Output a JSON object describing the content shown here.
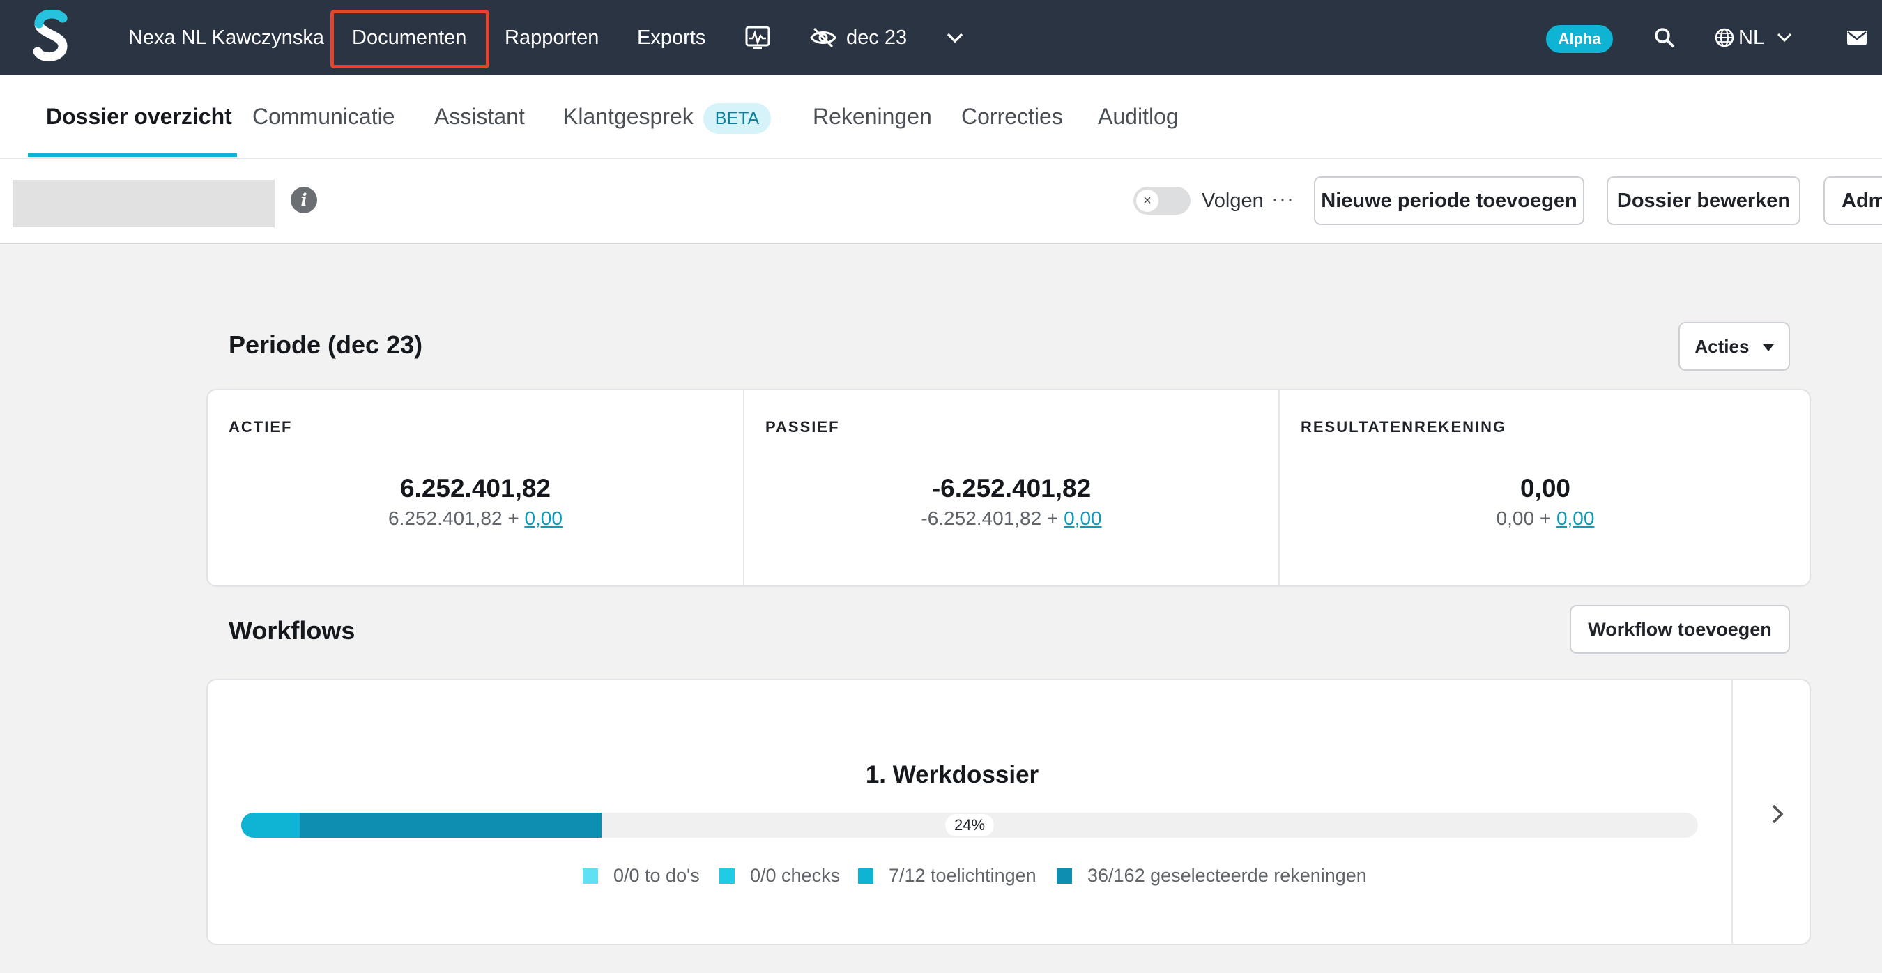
{
  "topnav": {
    "company": "Nexa NL Kawczynska",
    "items": [
      "Documenten",
      "Rapporten",
      "Exports"
    ],
    "period": "dec 23",
    "badge": "Alpha",
    "language": "NL",
    "icons": [
      "logo-icon",
      "activity-monitor-icon",
      "eye-off-icon",
      "chevron-down-icon",
      "search-icon",
      "globe-icon",
      "mail-icon"
    ]
  },
  "tabs": [
    {
      "label": "Dossier overzicht",
      "active": true
    },
    {
      "label": "Communicatie"
    },
    {
      "label": "Assistant"
    },
    {
      "label": "Klantgesprek",
      "badge": "BETA"
    },
    {
      "label": "Rekeningen"
    },
    {
      "label": "Correcties"
    },
    {
      "label": "Auditlog"
    }
  ],
  "toolbar": {
    "follow_label": "Volgen",
    "more": "···",
    "buttons": [
      "Nieuwe periode toevoegen",
      "Dossier bewerken",
      "Adm"
    ]
  },
  "period": {
    "title": "Periode (dec 23)",
    "actions_label": "Acties",
    "stats": [
      {
        "label": "ACTIEF",
        "value": "6.252.401,82",
        "base": "6.252.401,82 + ",
        "delta": "0,00"
      },
      {
        "label": "PASSIEF",
        "value": "-6.252.401,82",
        "base": "-6.252.401,82 + ",
        "delta": "0,00"
      },
      {
        "label": "RESULTATENREKENING",
        "value": "0,00",
        "base": "0,00 + ",
        "delta": "0,00"
      }
    ]
  },
  "workflows": {
    "title": "Workflows",
    "add_button": "Workflow toevoegen",
    "item": {
      "name": "1. Werkdossier",
      "progress_label": "24%",
      "progress_segments": [
        {
          "fraction": 0.04,
          "color": "#0fb3d3"
        },
        {
          "fraction": 0.207,
          "color": "#0d8fb1"
        }
      ],
      "legend": [
        {
          "label": "0/0 to do's",
          "color": "#5fe0f3"
        },
        {
          "label": "0/0 checks",
          "color": "#20cbe5"
        },
        {
          "label": "7/12 toelichtingen",
          "color": "#0fb3d3"
        },
        {
          "label": "36/162 geselecteerde rekeningen",
          "color": "#0d8fb1"
        }
      ]
    }
  }
}
